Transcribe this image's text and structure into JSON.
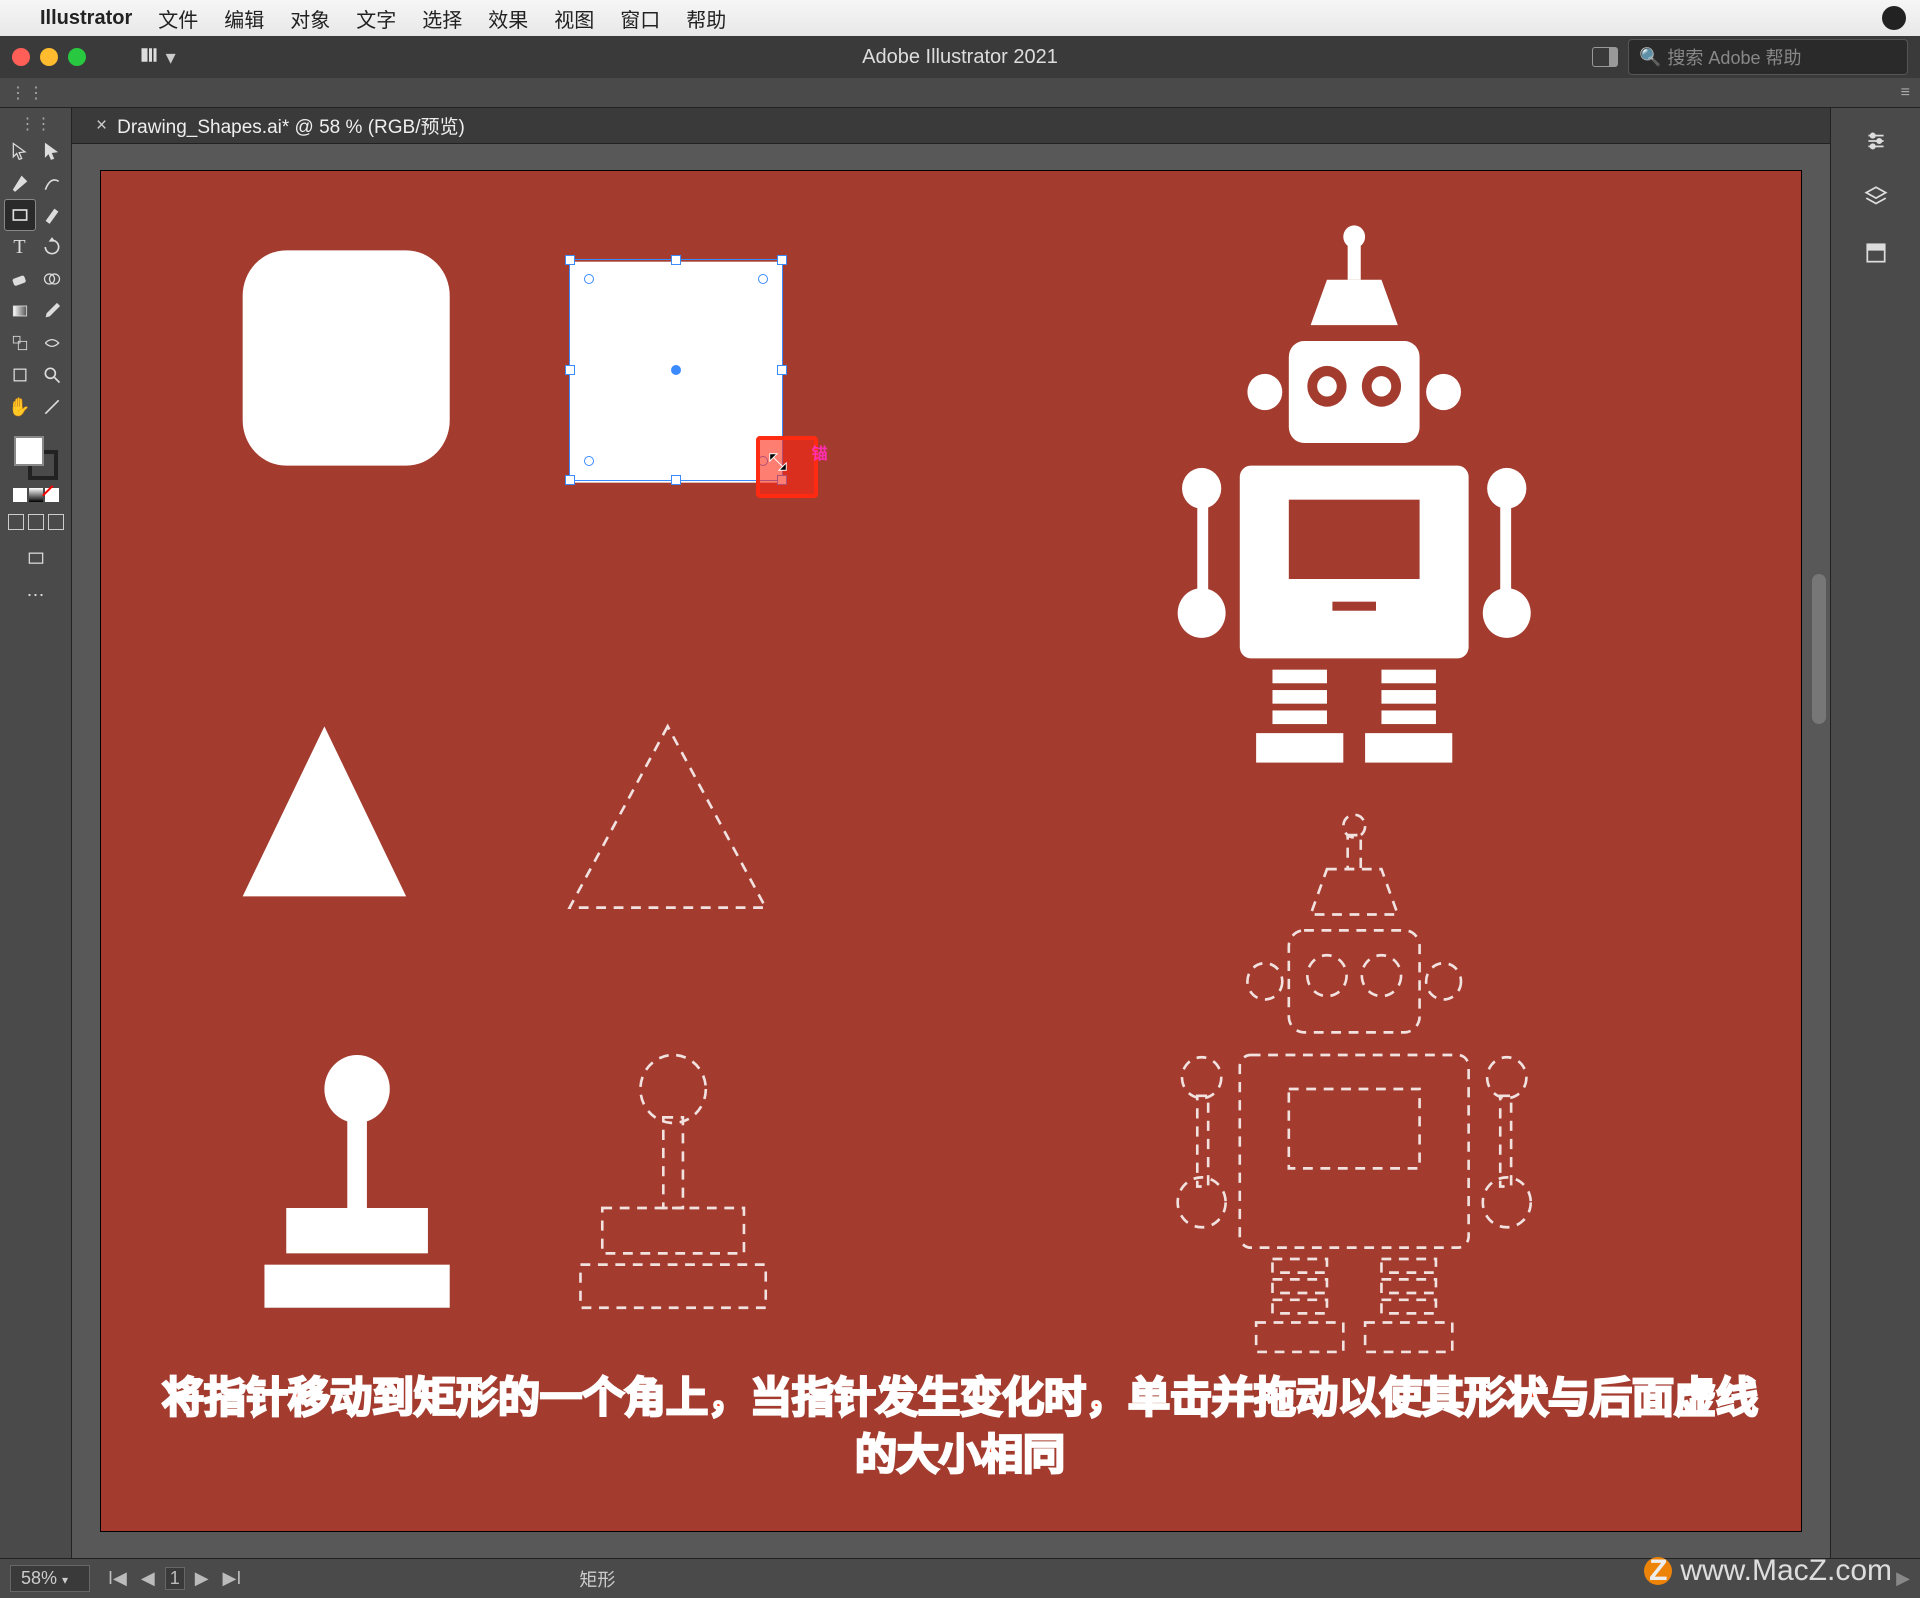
{
  "macos_menu": {
    "app": "Illustrator",
    "items": [
      "文件",
      "编辑",
      "对象",
      "文字",
      "选择",
      "效果",
      "视图",
      "窗口",
      "帮助"
    ]
  },
  "app_titlebar": {
    "title": "Adobe Illustrator 2021",
    "search_placeholder": "搜索 Adobe 帮助"
  },
  "document": {
    "tab_label": "Drawing_Shapes.ai* @ 58 % (RGB/预览)"
  },
  "selection": {
    "cursor_hint": "锚"
  },
  "status": {
    "zoom": "58%",
    "artboard_index": "1",
    "selection_label": "矩形"
  },
  "right_panel_icons": [
    "properties-icon",
    "layers-icon",
    "libraries-icon"
  ],
  "tutorial": {
    "line1": "将指针移动到矩形的一个角上，当指针发生变化时，单击并拖动以使其形状与后面虚线",
    "line2": "的大小相同"
  },
  "watermark": {
    "badge": "Z",
    "text": "www.MacZ.com"
  },
  "colors": {
    "artboard_bg": "#a33b2e",
    "selection_blue": "#3b8bff",
    "highlight": "#ff2a12"
  }
}
